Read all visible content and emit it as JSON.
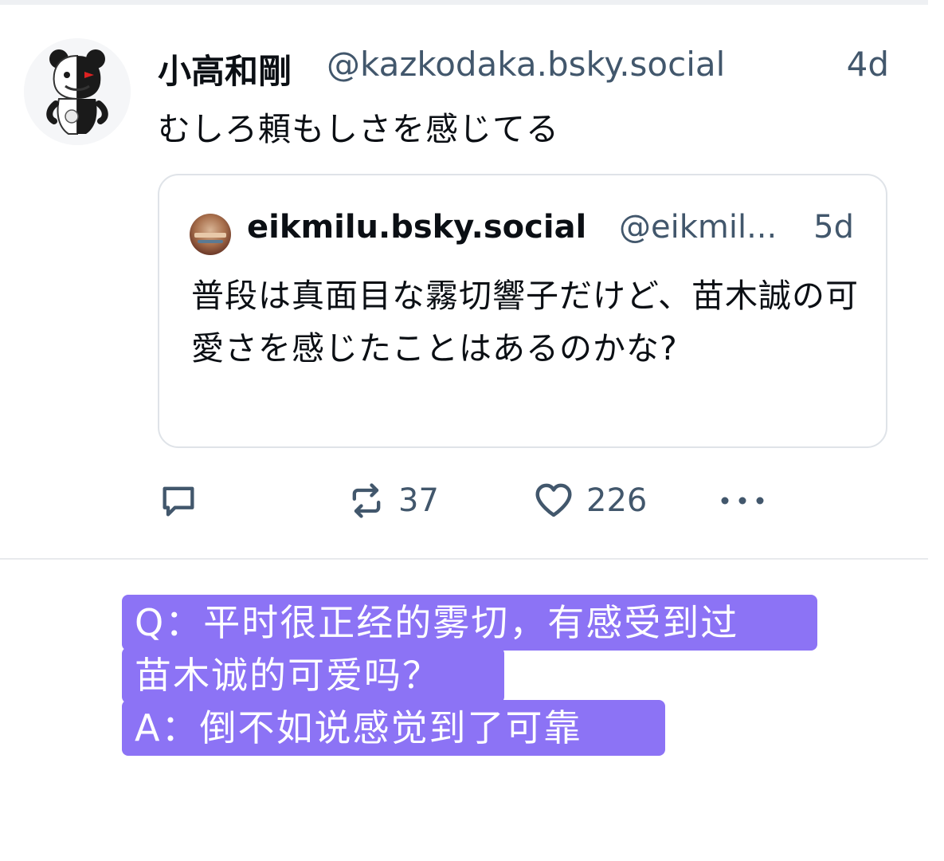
{
  "post": {
    "author": {
      "display_name": "小高和剛",
      "handle": "@kazkodaka.bsky.social",
      "avatar_icon": "monokuma-bear-avatar"
    },
    "time": "4d",
    "text": "むしろ頼もしさを感じてる",
    "quote": {
      "name": "eikmilu.bsky.social",
      "handle": "@eikmil...",
      "time": "5d",
      "text": "普段は真面目な霧切響子だけど、苗木誠の可愛さを感じたことはあるのかな?"
    },
    "actions": {
      "reply_icon": "reply-icon",
      "repost_icon": "repost-icon",
      "repost_count": "37",
      "like_icon": "heart-icon",
      "like_count": "226",
      "more_icon": "more-dots-icon"
    }
  },
  "caption": {
    "line1": "Q：平时很正经的雾切，有感受到过",
    "line2": "苗木诚的可爱吗？",
    "line3": "A：倒不如说感觉到了可靠",
    "highlight_color": "#8c73f5"
  },
  "colors": {
    "text": "#0b0f14",
    "muted": "#42576c",
    "border": "#dfe3e8"
  }
}
